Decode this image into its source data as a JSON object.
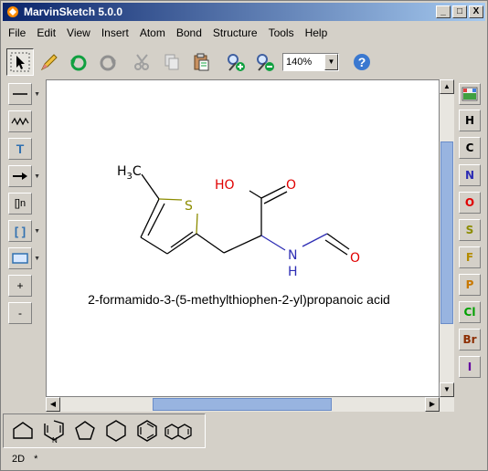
{
  "window": {
    "title": "MarvinSketch 5.0.0",
    "controls": [
      "_",
      "□",
      "X"
    ]
  },
  "menu": [
    "File",
    "Edit",
    "View",
    "Insert",
    "Atom",
    "Bond",
    "Structure",
    "Tools",
    "Help"
  ],
  "toolbar": {
    "zoom_value": "140%",
    "zoom_dropdown_arrow": "▼"
  },
  "left_tools": {
    "text_tool": "T",
    "sgroup_label": "[]n",
    "bracket_label": "[ ]",
    "plus_label": "+",
    "minus_label": "-"
  },
  "right_tools": {
    "elements": [
      {
        "symbol": "H",
        "color": "#000000"
      },
      {
        "symbol": "C",
        "color": "#000000"
      },
      {
        "symbol": "N",
        "color": "#2d2db4"
      },
      {
        "symbol": "O",
        "color": "#e00000"
      },
      {
        "symbol": "S",
        "color": "#8c8c00"
      },
      {
        "symbol": "F",
        "color": "#b48c00"
      },
      {
        "symbol": "P",
        "color": "#c87800"
      },
      {
        "symbol": "Cl",
        "color": "#00a000"
      },
      {
        "symbol": "Br",
        "color": "#8c2d00"
      },
      {
        "symbol": "I",
        "color": "#6400a0"
      }
    ]
  },
  "molecule": {
    "name": "2-formamido-3-(5-methylthiophen-2-yl)propanoic acid",
    "labels": {
      "methyl_h": "H",
      "methyl_sub": "3",
      "methyl_c": "C",
      "sulfur": "S",
      "hydroxyl": "HO",
      "carbonyl_o": "O",
      "amide_n": "N",
      "amide_h": "H",
      "formyl_o": "O"
    },
    "colors": {
      "oxygen": "#e00000",
      "nitrogen": "#2d2db4",
      "sulfur": "#8c8c00",
      "bond": "#000000"
    }
  },
  "status": {
    "mode": "2D",
    "modified": "*"
  }
}
